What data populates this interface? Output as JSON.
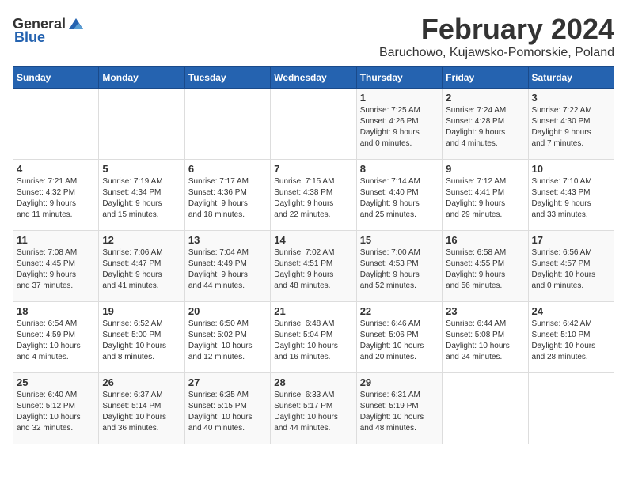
{
  "logo": {
    "general": "General",
    "blue": "Blue"
  },
  "title": "February 2024",
  "subtitle": "Baruchowo, Kujawsko-Pomorskie, Poland",
  "days_of_week": [
    "Sunday",
    "Monday",
    "Tuesday",
    "Wednesday",
    "Thursday",
    "Friday",
    "Saturday"
  ],
  "weeks": [
    [
      {
        "day": "",
        "info": ""
      },
      {
        "day": "",
        "info": ""
      },
      {
        "day": "",
        "info": ""
      },
      {
        "day": "",
        "info": ""
      },
      {
        "day": "1",
        "info": "Sunrise: 7:25 AM\nSunset: 4:26 PM\nDaylight: 9 hours\nand 0 minutes."
      },
      {
        "day": "2",
        "info": "Sunrise: 7:24 AM\nSunset: 4:28 PM\nDaylight: 9 hours\nand 4 minutes."
      },
      {
        "day": "3",
        "info": "Sunrise: 7:22 AM\nSunset: 4:30 PM\nDaylight: 9 hours\nand 7 minutes."
      }
    ],
    [
      {
        "day": "4",
        "info": "Sunrise: 7:21 AM\nSunset: 4:32 PM\nDaylight: 9 hours\nand 11 minutes."
      },
      {
        "day": "5",
        "info": "Sunrise: 7:19 AM\nSunset: 4:34 PM\nDaylight: 9 hours\nand 15 minutes."
      },
      {
        "day": "6",
        "info": "Sunrise: 7:17 AM\nSunset: 4:36 PM\nDaylight: 9 hours\nand 18 minutes."
      },
      {
        "day": "7",
        "info": "Sunrise: 7:15 AM\nSunset: 4:38 PM\nDaylight: 9 hours\nand 22 minutes."
      },
      {
        "day": "8",
        "info": "Sunrise: 7:14 AM\nSunset: 4:40 PM\nDaylight: 9 hours\nand 25 minutes."
      },
      {
        "day": "9",
        "info": "Sunrise: 7:12 AM\nSunset: 4:41 PM\nDaylight: 9 hours\nand 29 minutes."
      },
      {
        "day": "10",
        "info": "Sunrise: 7:10 AM\nSunset: 4:43 PM\nDaylight: 9 hours\nand 33 minutes."
      }
    ],
    [
      {
        "day": "11",
        "info": "Sunrise: 7:08 AM\nSunset: 4:45 PM\nDaylight: 9 hours\nand 37 minutes."
      },
      {
        "day": "12",
        "info": "Sunrise: 7:06 AM\nSunset: 4:47 PM\nDaylight: 9 hours\nand 41 minutes."
      },
      {
        "day": "13",
        "info": "Sunrise: 7:04 AM\nSunset: 4:49 PM\nDaylight: 9 hours\nand 44 minutes."
      },
      {
        "day": "14",
        "info": "Sunrise: 7:02 AM\nSunset: 4:51 PM\nDaylight: 9 hours\nand 48 minutes."
      },
      {
        "day": "15",
        "info": "Sunrise: 7:00 AM\nSunset: 4:53 PM\nDaylight: 9 hours\nand 52 minutes."
      },
      {
        "day": "16",
        "info": "Sunrise: 6:58 AM\nSunset: 4:55 PM\nDaylight: 9 hours\nand 56 minutes."
      },
      {
        "day": "17",
        "info": "Sunrise: 6:56 AM\nSunset: 4:57 PM\nDaylight: 10 hours\nand 0 minutes."
      }
    ],
    [
      {
        "day": "18",
        "info": "Sunrise: 6:54 AM\nSunset: 4:59 PM\nDaylight: 10 hours\nand 4 minutes."
      },
      {
        "day": "19",
        "info": "Sunrise: 6:52 AM\nSunset: 5:00 PM\nDaylight: 10 hours\nand 8 minutes."
      },
      {
        "day": "20",
        "info": "Sunrise: 6:50 AM\nSunset: 5:02 PM\nDaylight: 10 hours\nand 12 minutes."
      },
      {
        "day": "21",
        "info": "Sunrise: 6:48 AM\nSunset: 5:04 PM\nDaylight: 10 hours\nand 16 minutes."
      },
      {
        "day": "22",
        "info": "Sunrise: 6:46 AM\nSunset: 5:06 PM\nDaylight: 10 hours\nand 20 minutes."
      },
      {
        "day": "23",
        "info": "Sunrise: 6:44 AM\nSunset: 5:08 PM\nDaylight: 10 hours\nand 24 minutes."
      },
      {
        "day": "24",
        "info": "Sunrise: 6:42 AM\nSunset: 5:10 PM\nDaylight: 10 hours\nand 28 minutes."
      }
    ],
    [
      {
        "day": "25",
        "info": "Sunrise: 6:40 AM\nSunset: 5:12 PM\nDaylight: 10 hours\nand 32 minutes."
      },
      {
        "day": "26",
        "info": "Sunrise: 6:37 AM\nSunset: 5:14 PM\nDaylight: 10 hours\nand 36 minutes."
      },
      {
        "day": "27",
        "info": "Sunrise: 6:35 AM\nSunset: 5:15 PM\nDaylight: 10 hours\nand 40 minutes."
      },
      {
        "day": "28",
        "info": "Sunrise: 6:33 AM\nSunset: 5:17 PM\nDaylight: 10 hours\nand 44 minutes."
      },
      {
        "day": "29",
        "info": "Sunrise: 6:31 AM\nSunset: 5:19 PM\nDaylight: 10 hours\nand 48 minutes."
      },
      {
        "day": "",
        "info": ""
      },
      {
        "day": "",
        "info": ""
      }
    ]
  ]
}
